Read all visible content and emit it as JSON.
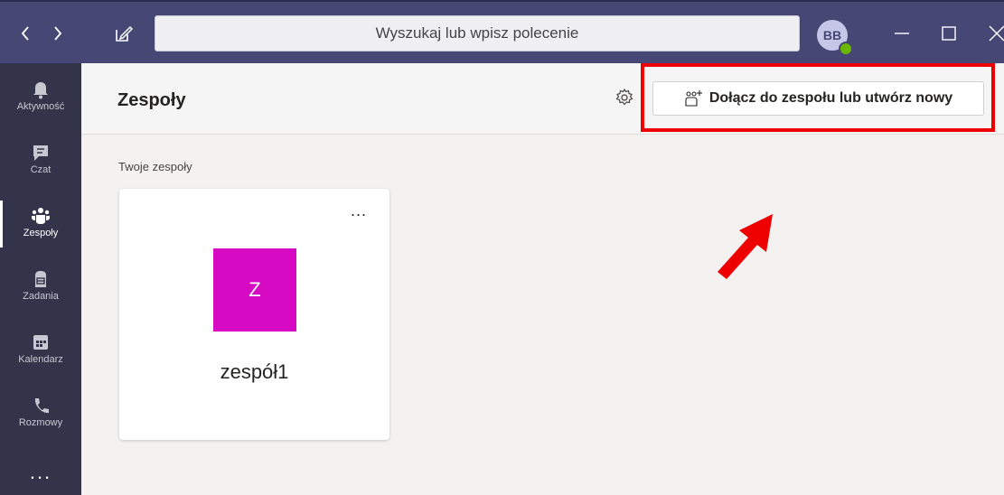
{
  "titlebar": {
    "search_placeholder": "Wyszukaj lub wpisz polecenie",
    "avatar_initials": "BB",
    "back_icon": "chevron-left-icon",
    "forward_icon": "chevron-right-icon",
    "compose_icon": "compose-icon",
    "presence_status": "available",
    "colors": {
      "bar": "#464775",
      "presence": "#6bb700"
    }
  },
  "appbar": {
    "items": [
      {
        "label": "Aktywność",
        "icon": "bell-icon"
      },
      {
        "label": "Czat",
        "icon": "chat-icon"
      },
      {
        "label": "Zespoły",
        "icon": "teams-icon",
        "active": true
      },
      {
        "label": "Zadania",
        "icon": "assignments-icon"
      },
      {
        "label": "Kalendarz",
        "icon": "calendar-icon"
      },
      {
        "label": "Rozmowy",
        "icon": "phone-icon"
      }
    ],
    "more": "..."
  },
  "header": {
    "title": "Zespoły",
    "join_button": "Dołącz do zespołu lub utwórz nowy"
  },
  "content": {
    "section_label": "Twoje zespoły",
    "teams": [
      {
        "initial": "Z",
        "name": "zespół1",
        "color": "#d60ac2",
        "more": "..."
      }
    ]
  },
  "annotation": {
    "color": "#ee0000"
  }
}
